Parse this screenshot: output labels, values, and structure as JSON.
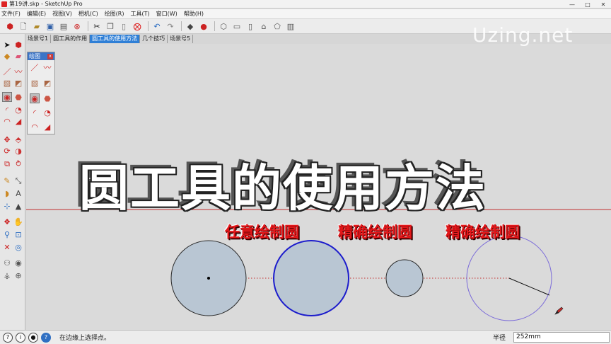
{
  "window": {
    "title": "第19讲.skp - SketchUp Pro",
    "minimize_icon": "minimize-icon",
    "maximize_icon": "maximize-icon",
    "close_icon": "close-icon"
  },
  "menu": [
    "文件(F)",
    "编辑(E)",
    "视图(V)",
    "相机(C)",
    "绘图(R)",
    "工具(T)",
    "窗口(W)",
    "帮助(H)"
  ],
  "toolbar": {
    "icons": [
      "sketchup-icon",
      "new-file-icon",
      "open-file-icon",
      "save-icon",
      "print-icon",
      "erase-model-icon",
      "cut-icon",
      "copy-icon",
      "paste-icon",
      "delete-icon",
      "undo-icon",
      "redo-icon",
      "components-icon",
      "shadow-icon",
      "iso-view-icon",
      "top-view-icon",
      "front-view-icon",
      "home-view-icon",
      "right-view-icon",
      "back-view-icon"
    ]
  },
  "scene_tabs": [
    "场景号1",
    "圆工具的作用",
    "圆工具的使用方法",
    "几个技巧",
    "场景号5"
  ],
  "active_scene_index": 2,
  "draw_panel": {
    "title": "绘图",
    "close_label": "x"
  },
  "viewport": {
    "headline": "圆工具的使用方法",
    "labels": [
      "任意绘制圆",
      "精确绘制圆",
      "精确绘制圆"
    ],
    "watermark": "Uzing.net"
  },
  "status": {
    "message": "在边缘上选择点。",
    "radius_label": "半径",
    "radius_value": "252mm",
    "icons": [
      "geo-location-icon",
      "info-icon",
      "user-icon",
      "help-icon"
    ]
  },
  "colors": {
    "circle_fill": "#b9c6d3",
    "circle_edge_default": "#2a2a2a",
    "circle_edge_selected": "#1c1ccc",
    "preview_circle": "#7a6ad9",
    "red_axis": "#c23030",
    "label_red": "#e3171a",
    "active_tab": "#2f7fd6"
  }
}
